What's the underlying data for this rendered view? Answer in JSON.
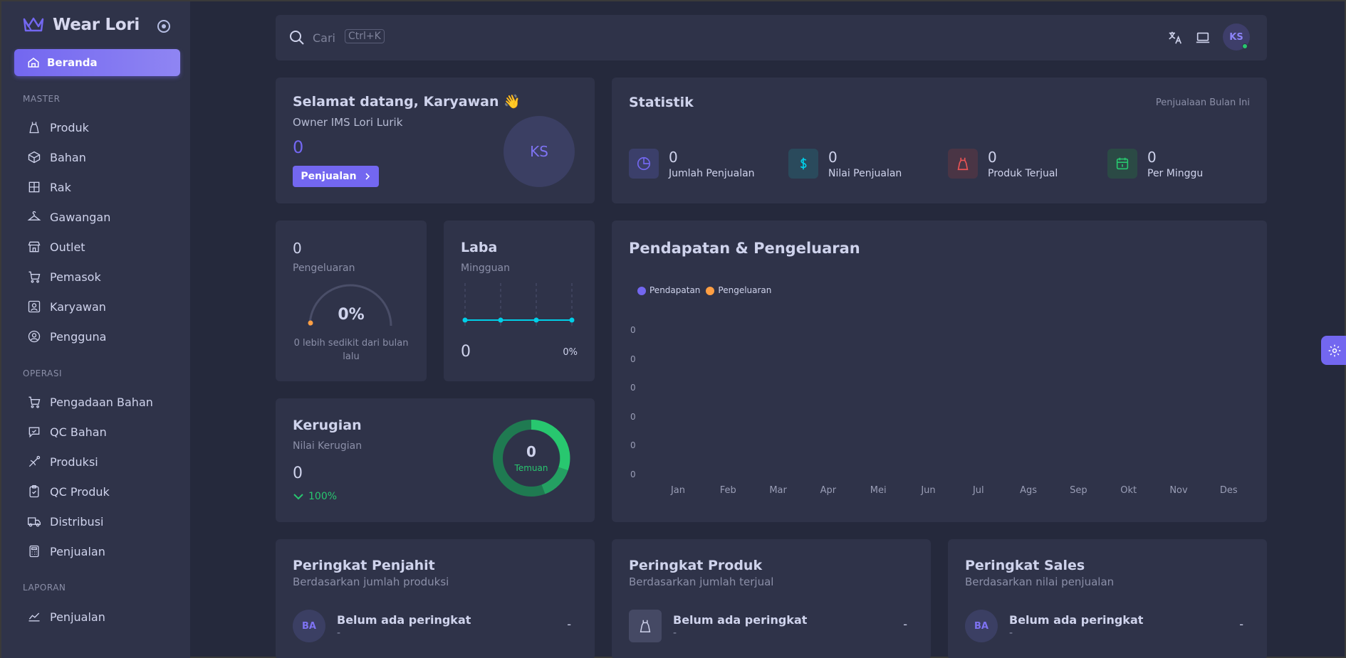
{
  "brand": {
    "name": "Wear Lori"
  },
  "sidebar": {
    "active": "Beranda",
    "sections": [
      {
        "title": "MASTER",
        "items": [
          "Produk",
          "Bahan",
          "Rak",
          "Gawangan",
          "Outlet",
          "Pemasok",
          "Karyawan",
          "Pengguna"
        ]
      },
      {
        "title": "OPERASI",
        "items": [
          "Pengadaan Bahan",
          "QC Bahan",
          "Produksi",
          "QC Produk",
          "Distribusi",
          "Penjualan"
        ]
      },
      {
        "title": "LAPORAN",
        "items": [
          "Penjualan"
        ]
      }
    ]
  },
  "topbar": {
    "search_placeholder": "Cari",
    "shortcut": "Ctrl+K",
    "avatar": "KS"
  },
  "welcome": {
    "title": "Selamat datang, Karyawan 👋",
    "subtitle": "Owner IMS Lori Lurik",
    "value": "0",
    "button": "Penjualan",
    "avatar": "KS"
  },
  "statistik": {
    "title": "Statistik",
    "period": "Penjualaan Bulan Ini",
    "items": [
      {
        "value": "0",
        "label": "Jumlah Penjualan",
        "icon": "pie-chart-icon",
        "color": "#7367f0"
      },
      {
        "value": "0",
        "label": "Nilai Penjualan",
        "icon": "dollar-icon",
        "color": "#00cfe8"
      },
      {
        "value": "0",
        "label": "Produk Terjual",
        "icon": "dress-icon",
        "color": "#ea5455"
      },
      {
        "value": "0",
        "label": "Per Minggu",
        "icon": "calendar-icon",
        "color": "#28c76f"
      }
    ]
  },
  "pengeluaran": {
    "value": "0",
    "label": "Pengeluaran",
    "percent": "0%",
    "percent_value": 0,
    "note": "0 lebih sedikit dari bulan lalu"
  },
  "laba": {
    "title": "Laba",
    "subtitle": "Mingguan",
    "value": "0",
    "percent": "0%"
  },
  "kerugian": {
    "title": "Kerugian",
    "subtitle": "Nilai Kerugian",
    "value": "0",
    "change": "100%",
    "donut_value": "0",
    "donut_label": "Temuan"
  },
  "chart_data": {
    "type": "line",
    "title": "Pendapatan & Pengeluaran",
    "categories": [
      "Jan",
      "Feb",
      "Mar",
      "Apr",
      "Mei",
      "Jun",
      "Jul",
      "Ags",
      "Sep",
      "Okt",
      "Nov",
      "Des"
    ],
    "series": [
      {
        "name": "Pendapatan",
        "color": "#7367f0",
        "values": [
          0,
          0,
          0,
          0,
          0,
          0,
          0,
          0,
          0,
          0,
          0,
          0
        ]
      },
      {
        "name": "Pengeluaran",
        "color": "#ff9f43",
        "values": [
          0,
          0,
          0,
          0,
          0,
          0,
          0,
          0,
          0,
          0,
          0,
          0
        ]
      }
    ],
    "y_ticks": [
      "0",
      "0",
      "0",
      "0",
      "0",
      "0"
    ],
    "legend_position": "top-left"
  },
  "rankings": [
    {
      "title": "Peringkat Penjahit",
      "subtitle": "Berdasarkan jumlah produksi",
      "avatar": "BA",
      "name": "Belum ada peringkat",
      "detail": "-",
      "value": "-"
    },
    {
      "title": "Peringkat Produk",
      "subtitle": "Berdasarkan jumlah terjual",
      "avatar": "",
      "name": "Belum ada peringkat",
      "detail": "-",
      "value": "-"
    },
    {
      "title": "Peringkat Sales",
      "subtitle": "Berdasarkan nilai penjualan",
      "avatar": "BA",
      "name": "Belum ada peringkat",
      "detail": "-",
      "value": "-"
    }
  ]
}
